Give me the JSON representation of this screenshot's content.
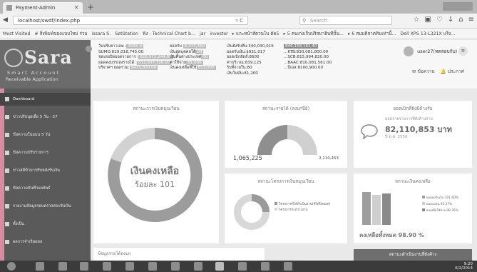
{
  "browser": {
    "tab_title": "Payment-Admin",
    "tab_close": "×",
    "new_tab": "+",
    "url": "localhost/swdf/index.php",
    "url_controls": "▿ C",
    "search_placeholder": "Search",
    "bookmarks": [
      "Most Visited",
      "# สิ่งพิมพ์ของแบบใหม่ ร่วม",
      "issara S.",
      "SetStation",
      "ฟัง - Technical Chart b...",
      "jar",
      "investor",
      "▸ แกะหน้าสัดวนใน ดัด5",
      "▸ 5 คนเก่งเก็บปริสมาธินทีนั้น...",
      "▸ 6 สมมดิลาดทิมเท่านี้...",
      "Dell XPS 13-L321X แร็ง..."
    ]
  },
  "app": {
    "logo_word": "Sara",
    "logo_sub1": "Smart Account",
    "logo_sub2": "Receivable Application",
    "header": {
      "col1": [
        {
          "label": "วันปรับยาวเลม :",
          "value": "2556 ม"
        },
        {
          "label": "SUMO:",
          "value": "829,018,745.00"
        },
        {
          "label": "ชดเลยปัดยอดรายการ :",
          "value": "826,972,244.00"
        },
        {
          "label": "ยอดคงบรรเลงรายได้ :",
          "value": "812,937,320.00"
        },
        {
          "label": "บริจาคฯ ยอดรวม:",
          "value": "$415,800.00"
        }
      ],
      "col2": [
        {
          "label": "ยอดรับ ",
          "value": "8,373,359"
        },
        {
          "label": "เงินสูดบุคคลใต้",
          "value": "00"
        },
        {
          "label": "เงินคืนต่างประเทศ",
          "value": "00"
        },
        {
          "label": "ค่าใช้จ่าย",
          "value": "81,000"
        },
        {
          "label": "เงินคงเหลือที่ใช้",
          "value": "813,000"
        }
      ],
      "col3": [
        {
          "label": "เงินยังรับทีบ:",
          "value": "340,030,019"
        },
        {
          "label": "ยอดรับเงิน:",
          "value": "$931,017"
        },
        {
          "label": "ยอดเบิกยัดส์:",
          "value": "8600"
        },
        {
          "label": "ค่าบริเวณ:",
          "value": "839,125"
        },
        {
          "label": "รับที่จ่ายใน:",
          "value": "80"
        },
        {
          "label": "เงินในบัน:",
          "value": "81,200"
        }
      ],
      "col4": [
        {
          "label": "",
          "value": "846,158,161.40"
        },
        {
          "label": "...KTB:",
          "value": "830,081,800.00"
        },
        {
          "label": "...SCB:",
          "value": "815,994,820.00"
        },
        {
          "label": "...BAAC:",
          "value": "810,081,561.00"
        },
        {
          "label": "...บีเอส:",
          "value": "8100,900.00"
        }
      ]
    },
    "user_name": "user27(ทดสอบกับ) ▾",
    "user_more": "≡",
    "links": [
      "✉ ข้อความ",
      "🔔 ประกาศ"
    ]
  },
  "sidebar": {
    "accent": "#d98ba0",
    "items": [
      {
        "label": "Dashboard",
        "active": true
      },
      {
        "label": "ข่าวปรับนุยเลื่อ 5 วัน - 57"
      },
      {
        "label": "ข้อความในอแน 5 วัน"
      },
      {
        "label": "ข้อความปรับรายการ"
      },
      {
        "label": "ข่าวสดีข้ามาปรับหลังรับเงิน"
      },
      {
        "label": "ข้อความบันทึกผลลัพธ์"
      },
      {
        "label": "รายงานข้อมูลรอบตรวจสอบรับเงิน"
      },
      {
        "label": "ตั้งเป็น"
      },
      {
        "label": "ผลการจำเริ่มผลล"
      }
    ]
  },
  "cards": {
    "status": {
      "title": "สถานะการเงินหมุนเวียน",
      "center_main": "เงินคงเหลือ",
      "center_sub": "ร้อยละ 101"
    },
    "income": {
      "title": "สถานะรายได้ (ลงบกปีย์)",
      "left": "1,065,225",
      "right": "2,110,453",
      "fraction": 0.5
    },
    "due": {
      "title": "ยอดเบิกที่ยังมีค้างรับ",
      "sub": "ยอดจ่ายรายการที่ยังค้างจ่าย",
      "amount": "82,110,853 บาท",
      "date": "ปี ด.ศ. 2556"
    },
    "project": {
      "title": "สถานะโครงการเงินหมุนเวียน",
      "legend": [
        "โครงการที่ได้ดำเนินงาน(ที่ได้ปิดยอด)",
        "โครงการระหว่างงาน"
      ]
    },
    "balance": {
      "title": "สถานะเงินคงเหลือ",
      "legend": [
        "ยอดคงรับเงิน 101.60%",
        "ยอดลงทุน 95.27%",
        "คงเหลือใช้จ่าย 99.76%"
      ],
      "footer": "คงเหลือทั้งหมด 98.90 %"
    }
  },
  "bottom": {
    "left_label": "ข้อมูลรายได้ลงบก",
    "right_label": "สถานะดำเนินงานที่ยังค้าง"
  },
  "taskbar": {
    "time": "9:20",
    "date": "6/2/2014"
  }
}
